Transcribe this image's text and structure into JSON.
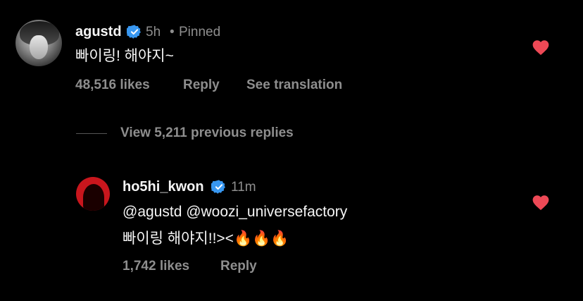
{
  "top_comment": {
    "username": "agustd",
    "time": "5h",
    "pinned_separator": "•",
    "pinned_label": "Pinned",
    "text": "빠이링! 해야지~",
    "likes": "48,516 likes",
    "reply_label": "Reply",
    "translate_label": "See translation",
    "heart_icon": "heart-filled-icon",
    "heart_color": "#ed4956"
  },
  "thread": {
    "view_replies_label": "View 5,211 previous replies"
  },
  "reply_comment": {
    "username": "ho5hi_kwon",
    "time": "11m",
    "line1": "@agustd @woozi_universefactory",
    "line2": "빠이링 해야지!!><🔥🔥🔥",
    "likes": "1,742 likes",
    "reply_label": "Reply",
    "heart_icon": "heart-filled-icon",
    "heart_color": "#ed4956"
  },
  "colors": {
    "background": "#000000",
    "text_primary": "#f5f5f5",
    "text_secondary": "#8e8e8e",
    "verified_blue": "#3897f0",
    "heart_red": "#ed4956"
  }
}
